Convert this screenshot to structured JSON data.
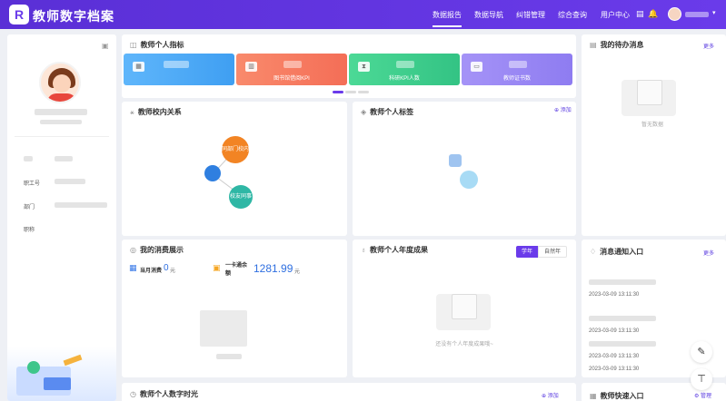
{
  "app": {
    "title": "教师数字档案",
    "logo": "R"
  },
  "nav": [
    "数据报告",
    "数据导航",
    "纠错管理",
    "综合查询",
    "用户中心"
  ],
  "nav_active": 0,
  "top_icons": [
    "document-icon",
    "bell-icon",
    "user-avatar"
  ],
  "profile": {
    "fields": [
      {
        "label": ""
      },
      {
        "label": "职工号"
      },
      {
        "label": "部门"
      },
      {
        "label": "职称"
      }
    ]
  },
  "indicators": {
    "title": "教师个人指标",
    "tiles": [
      {
        "label": ""
      },
      {
        "label": "图书馆借阅KPI"
      },
      {
        "label": "科研KPI人数"
      },
      {
        "label": "教师证书数"
      }
    ]
  },
  "todo": {
    "title": "我的待办消息",
    "more": "更多",
    "empty": "暂无数据"
  },
  "relations": {
    "title": "教师校内关系",
    "nodes": [
      "同部门校内同事",
      "校友同事"
    ]
  },
  "tags": {
    "title": "教师个人标签",
    "add": "添加"
  },
  "consumption": {
    "title": "我的消费展示",
    "month_label": "当月消费",
    "month_value": "0",
    "unit": "元",
    "card_label": "一卡通余额",
    "card_value": "1281.99",
    "card_unit": "元"
  },
  "achievements": {
    "title": "教师个人年度成果",
    "tabs": [
      "学年",
      "自然年"
    ],
    "empty": "还没有个人年度成果哦~"
  },
  "notices": {
    "title": "消息通知入口",
    "more": "更多",
    "items": [
      {
        "time": "2023-03-09 13:11:30"
      },
      {
        "time": "2023-03-09 13:11:30"
      },
      {
        "time": "2023-03-09 13:11:30"
      },
      {
        "time": "2023-03-09 13:11:30"
      }
    ]
  },
  "digital_time": {
    "title": "教师个人数字时光",
    "add": "添加"
  },
  "quick": {
    "title": "教师快速入口",
    "manage": "管理"
  },
  "colors": {
    "brand": "#6a3bea",
    "tile_blue": "#4aa8f5",
    "tile_orange": "#f37d62",
    "tile_green": "#3fd08e",
    "tile_purple": "#9a86f4",
    "relation_orange": "#f28424",
    "relation_teal": "#2fb7a5",
    "card_value_blue": "#2f6fe0"
  }
}
